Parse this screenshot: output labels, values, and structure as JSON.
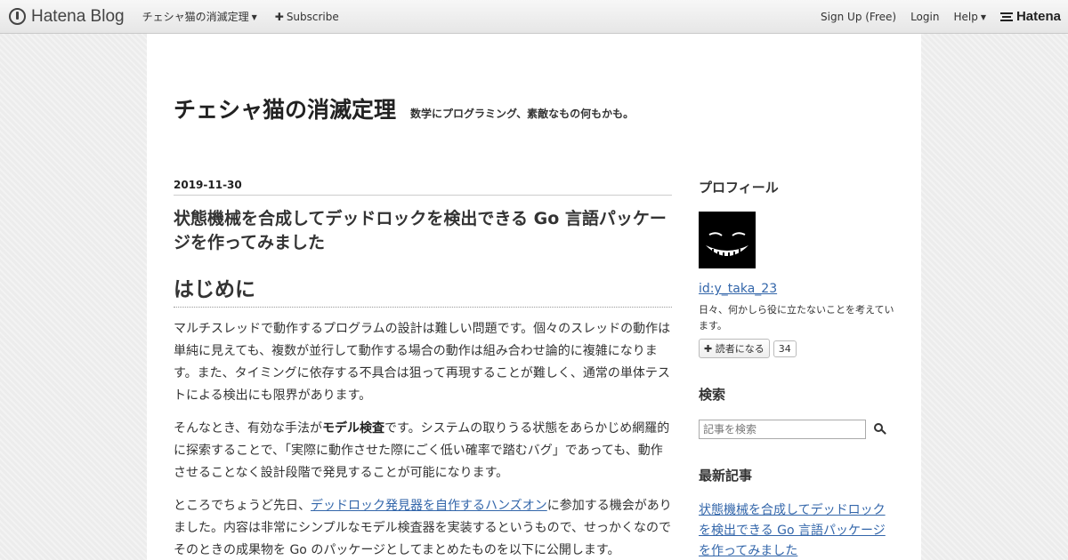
{
  "topbar": {
    "brand": "Hatena Blog",
    "blog_menu": "チェシャ猫の消滅定理",
    "subscribe": "Subscribe",
    "signup": "Sign Up (Free)",
    "login": "Login",
    "help": "Help",
    "hatena": "Hatena"
  },
  "blog": {
    "title": "チェシャ猫の消滅定理",
    "description": "数学にプログラミング、素敵なもの何もかも。"
  },
  "entry": {
    "date": "2019-11-30",
    "title": "状態機械を合成してデッドロックを検出できる Go 言語パッケージを作ってみました",
    "section_heading": "はじめに",
    "para1": "マルチスレッドで動作するプログラムの設計は難しい問題です。個々のスレッドの動作は単純に見えても、複数が並行して動作する場合の動作は組み合わせ論的に複雑になります。また、タイミングに依存する不具合は狙って再現することが難しく、通常の単体テストによる検出にも限界があります。",
    "para2_before": "そんなとき、有効な手法が",
    "para2_bold": "モデル検査",
    "para2_after": "です。システムの取りうる状態をあらかじめ網羅的に探索することで、「実際に動作させた際にごく低い確率で踏むバグ」であっても、動作させることなく設計段階で発見することが可能になります。",
    "para3_before": "ところでちょうど先日、",
    "para3_link": "デッドロック発見器を自作するハンズオン",
    "para3_after": "に参加する機会がありました。内容は非常にシンプルなモデル検査器を実装するというもので、せっかくなのでそのときの成果物を Go のパッケージとしてまとめたものを以下に公開します。"
  },
  "sidebar": {
    "profile_heading": "プロフィール",
    "profile_id": "id:y_taka_23",
    "profile_desc": "日々、何かしら役に立たないことを考えています。",
    "follow_label": "読者になる",
    "follow_count": "34",
    "search_heading": "検索",
    "search_placeholder": "記事を検索",
    "recent_heading": "最新記事",
    "recent_items": [
      "状態機械を合成してデッドロックを検出できる Go 言語パッケージを作ってみました"
    ]
  }
}
